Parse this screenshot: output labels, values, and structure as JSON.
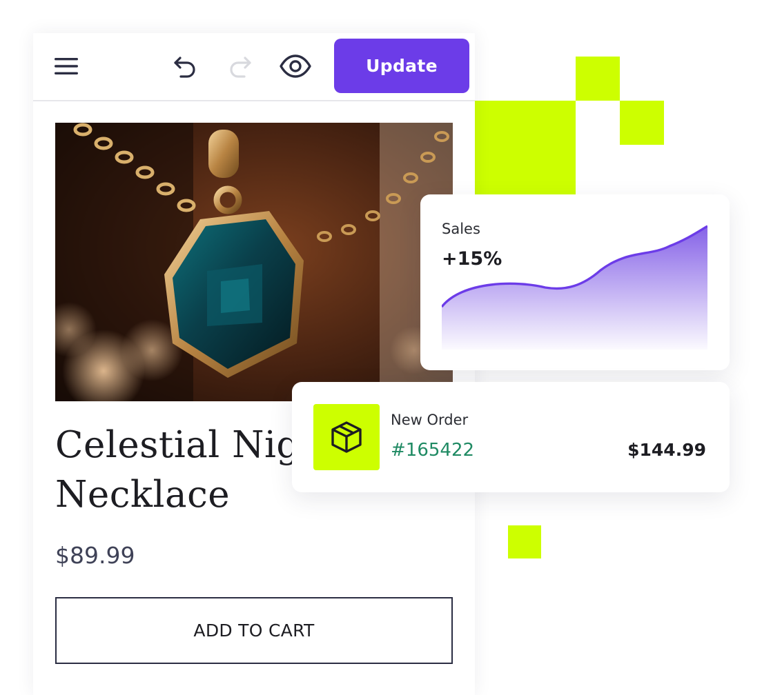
{
  "toolbar": {
    "menu_icon": "hamburger-menu-icon",
    "undo_icon": "undo-icon",
    "redo_icon": "redo-icon",
    "preview_icon": "eye-icon",
    "update_label": "Update"
  },
  "product": {
    "image": "emerald-pendant-necklace-photo",
    "title_line1": "Celestial Nigh",
    "title_line2": "Necklace",
    "price": "$89.99",
    "add_to_cart_label": "ADD TO CART"
  },
  "sales_card": {
    "label": "Sales",
    "value": "+15%"
  },
  "order_card": {
    "icon": "package-box-icon",
    "label": "New Order",
    "order_id": "#165422",
    "amount": "$144.99"
  },
  "colors": {
    "accent_purple": "#6c3ce8",
    "lime": "#cdff00",
    "order_id_green": "#1f8a63"
  }
}
